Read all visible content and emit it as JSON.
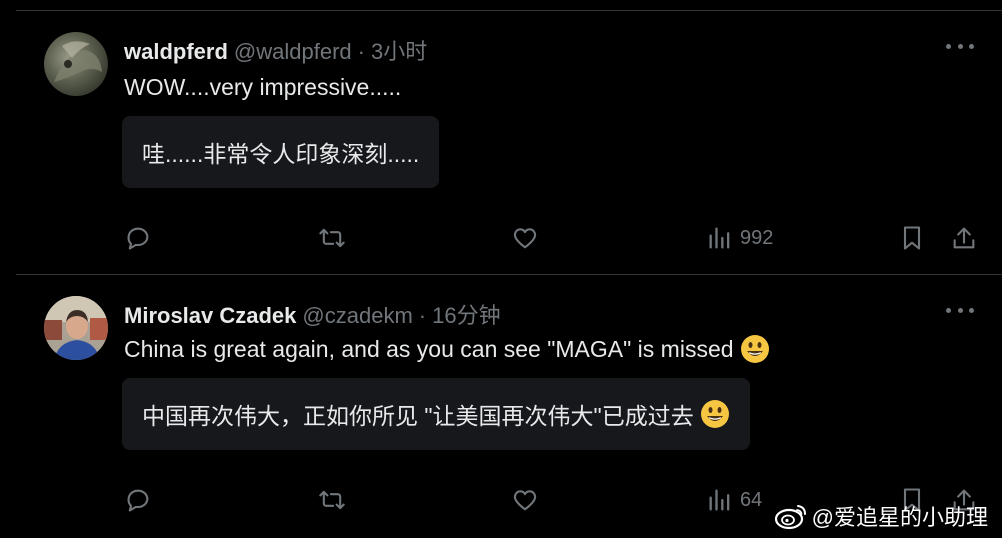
{
  "tweets": [
    {
      "display_name": "waldpferd",
      "handle": "@waldpferd",
      "separator": "·",
      "time": "3小时",
      "text": "WOW....very impressive.....",
      "translation": "哇......非常令人印象深刻.....",
      "views": "992",
      "has_emoji": false
    },
    {
      "display_name": "Miroslav Czadek",
      "handle": "@czadekm",
      "separator": "·",
      "time": "16分钟",
      "text": "China is great again, and as you can see  \"MAGA\" is missed",
      "translation": "中国再次伟大，正如你所见 \"让美国再次伟大\"已成过去",
      "views": "64",
      "has_emoji": true
    }
  ],
  "icons": {
    "reply": "reply-icon",
    "retweet": "retweet-icon",
    "like": "like-icon",
    "views": "views-icon",
    "bookmark": "bookmark-icon",
    "share": "share-icon",
    "more": "more-icon",
    "emoji": "grinning-face-emoji",
    "watermark_logo": "weibo-logo-icon"
  },
  "watermark": {
    "text": "@爱追星的小助理"
  },
  "colors": {
    "background": "#000000",
    "text": "#e7e9ea",
    "muted": "#71767b",
    "translation_box": "#16181c",
    "divider": "#2f3336"
  }
}
